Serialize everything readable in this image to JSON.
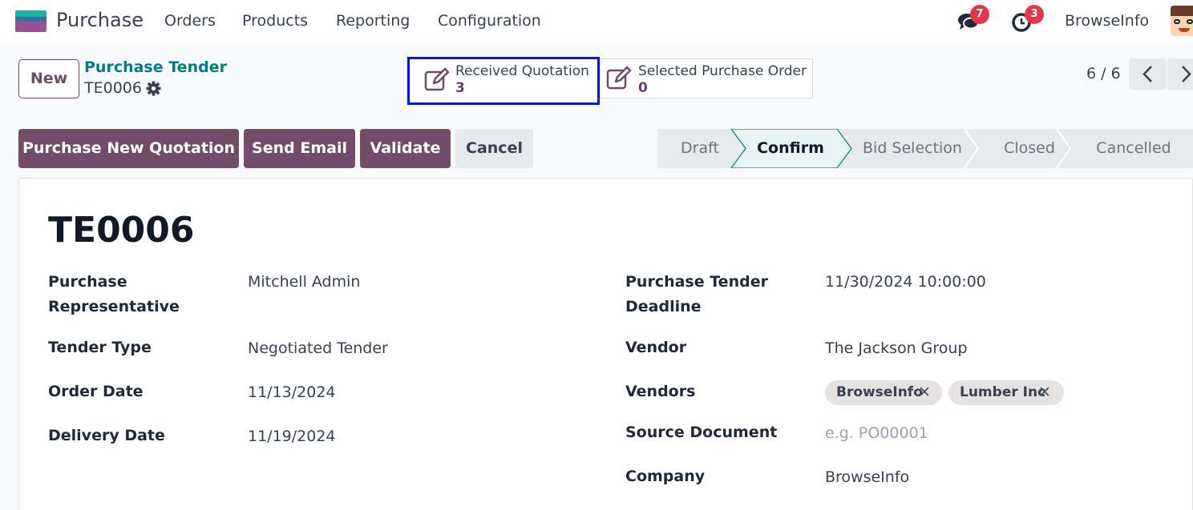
{
  "navbar": {
    "app_name": "Purchase",
    "menu": [
      "Orders",
      "Products",
      "Reporting",
      "Configuration"
    ],
    "messages_count": "7",
    "activities_count": "3",
    "company": "BrowseInfo"
  },
  "control_panel": {
    "new_label": "New",
    "breadcrumb": "Purchase Tender",
    "record_name": "TE0006",
    "smart_buttons": [
      {
        "label": "Received Quotation",
        "value": "3"
      },
      {
        "label": "Selected Purchase Order",
        "value": "0"
      }
    ],
    "pager": "6 / 6"
  },
  "actions": {
    "purchase_new_quotation": "Purchase New Quotation",
    "send_email": "Send Email",
    "validate": "Validate",
    "cancel": "Cancel"
  },
  "statusbar": {
    "stages": [
      "Draft",
      "Confirm",
      "Bid Selection",
      "Closed",
      "Cancelled"
    ],
    "active": "Confirm"
  },
  "form": {
    "title": "TE0006",
    "purchase_representative_label": "Purchase Representative",
    "purchase_representative": "Mitchell Admin",
    "tender_type_label": "Tender Type",
    "tender_type": "Negotiated Tender",
    "order_date_label": "Order Date",
    "order_date": "11/13/2024",
    "delivery_date_label": "Delivery Date",
    "delivery_date": "11/19/2024",
    "deadline_label": "Purchase Tender Deadline",
    "deadline": "11/30/2024 10:00:00",
    "vendor_label": "Vendor",
    "vendor": "The Jackson Group",
    "vendors_label": "Vendors",
    "vendors": [
      "BrowseInfo",
      "Lumber Inc"
    ],
    "source_document_label": "Source Document",
    "source_document_placeholder": "e.g. PO00001",
    "company_label": "Company",
    "company": "BrowseInfo"
  },
  "colors": {
    "primary": "#714b67",
    "accent_teal": "#017e84",
    "badge": "#e3374a",
    "highlight_border": "#0a14d6"
  }
}
